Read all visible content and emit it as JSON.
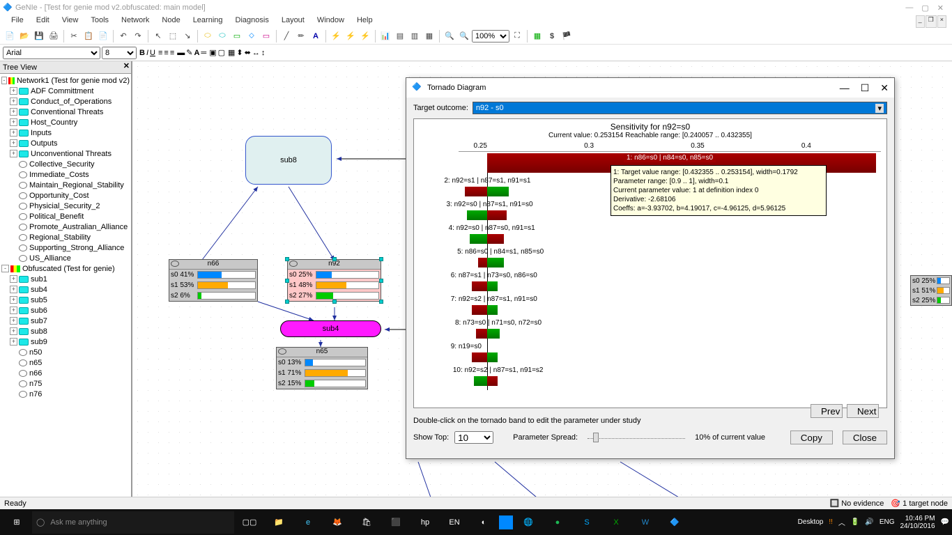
{
  "app": {
    "title": "GeNIe - [Test for genie mod v2.obfuscated: main model]"
  },
  "menu": {
    "items": [
      "File",
      "Edit",
      "View",
      "Tools",
      "Network",
      "Node",
      "Learning",
      "Diagnosis",
      "Layout",
      "Window",
      "Help"
    ]
  },
  "zoom": "100%",
  "font": {
    "name": "Arial",
    "size": "8"
  },
  "treeview": {
    "title": "Tree View",
    "root": "Network1 (Test for genie mod v2)",
    "group1": [
      "ADF Committment",
      "Conduct_of_Operations",
      "Conventional Threats",
      "Host_Country",
      "Inputs",
      "Outputs",
      "Unconventional Threats"
    ],
    "group2": [
      "Collective_Security",
      "Immediate_Costs",
      "Maintain_Regional_Stability",
      "Opportunity_Cost",
      "Physicial_Security_2",
      "Political_Benefit",
      "Promote_Australian_Alliance",
      "Regional_Stability",
      "Supporting_Strong_Alliance",
      "US_Alliance"
    ],
    "root2": "Obfuscated (Test for genie)",
    "group3": [
      "sub1",
      "sub4",
      "sub5",
      "sub6",
      "sub7",
      "sub8",
      "sub9"
    ],
    "group4": [
      "n50",
      "n65",
      "n66",
      "n75",
      "n76"
    ]
  },
  "nodes": {
    "sub8": "sub8",
    "sub4": "sub4",
    "n66": {
      "name": "n66",
      "rows": [
        {
          "l": "s0 41%",
          "w": 41,
          "c": "#08f"
        },
        {
          "l": "s1 53%",
          "w": 53,
          "c": "#fa0"
        },
        {
          "l": "s2  6%",
          "w": 6,
          "c": "#0c0"
        }
      ]
    },
    "n92": {
      "name": "n92",
      "rows": [
        {
          "l": "s0 25%",
          "w": 25,
          "c": "#08f"
        },
        {
          "l": "s1 48%",
          "w": 48,
          "c": "#fa0"
        },
        {
          "l": "s2 27%",
          "w": 27,
          "c": "#0c0"
        }
      ]
    },
    "n65": {
      "name": "n65",
      "rows": [
        {
          "l": "s0 13%",
          "w": 13,
          "c": "#08f"
        },
        {
          "l": "s1 71%",
          "w": 71,
          "c": "#fa0"
        },
        {
          "l": "s2 15%",
          "w": 15,
          "c": "#0c0"
        }
      ]
    },
    "partial": {
      "rows": [
        {
          "l": "s0 25%",
          "w": 25,
          "c": "#08f"
        },
        {
          "l": "s1 51%",
          "w": 51,
          "c": "#fa0"
        },
        {
          "l": "s2 25%",
          "w": 25,
          "c": "#0c0"
        }
      ]
    }
  },
  "dialog": {
    "title": "Tornado Diagram",
    "target_label": "Target outcome:",
    "target_value": "n92 - s0",
    "hint": "Double-click on the tornado band to edit the parameter under study",
    "show_top_label": "Show Top:",
    "show_top_value": "10",
    "spread_label": "Parameter Spread:",
    "spread_value": "10% of current value",
    "prev": "Prev",
    "next": "Next",
    "copy": "Copy",
    "close": "Close"
  },
  "chart_data": {
    "type": "bar",
    "title": "Sensitivity for n92=s0",
    "subtitle": "Current value: 0.253154  Reachable range: [0.240057 .. 0.432355]",
    "xticks": [
      0.25,
      0.3,
      0.35,
      0.4
    ],
    "xmin": 0.24,
    "xmax": 0.435,
    "current": 0.253154,
    "rows": [
      {
        "i": 1,
        "label": "1: n86=s0 | n84=s0, n85=s0",
        "lo": 0.253,
        "hi": 0.432,
        "lcol": "red",
        "rcol": "red",
        "full": true
      },
      {
        "i": 2,
        "label": "2: n92=s1 | n87=s1, n91=s1",
        "lo": 0.243,
        "hi": 0.263,
        "lcol": "red",
        "rcol": "grn"
      },
      {
        "i": 3,
        "label": "3: n92=s0 | n87=s1, n91=s0",
        "lo": 0.244,
        "hi": 0.262,
        "lcol": "grn",
        "rcol": "red"
      },
      {
        "i": 4,
        "label": "4: n92=s0 | n87=s0, n91=s1",
        "lo": 0.245,
        "hi": 0.261,
        "lcol": "grn",
        "rcol": "red"
      },
      {
        "i": 5,
        "label": "5: n86=s0 | n84=s1, n85=s0",
        "lo": 0.249,
        "hi": 0.261,
        "lcol": "red",
        "rcol": "grn"
      },
      {
        "i": 6,
        "label": "6: n87=s1 | n73=s0, n86=s0",
        "lo": 0.246,
        "hi": 0.258,
        "lcol": "red",
        "rcol": "grn"
      },
      {
        "i": 7,
        "label": "7: n92=s2 | n87=s1, n91=s0",
        "lo": 0.246,
        "hi": 0.258,
        "lcol": "red",
        "rcol": "grn"
      },
      {
        "i": 8,
        "label": "8: n73=s0 | n71=s0, n72=s0",
        "lo": 0.248,
        "hi": 0.259,
        "lcol": "red",
        "rcol": "grn"
      },
      {
        "i": 9,
        "label": "9: n19=s0",
        "lo": 0.246,
        "hi": 0.258,
        "lcol": "red",
        "rcol": "grn"
      },
      {
        "i": 10,
        "label": "10: n92=s2 | n87=s1, n91=s2",
        "lo": 0.247,
        "hi": 0.258,
        "lcol": "grn",
        "rcol": "red"
      }
    ]
  },
  "tooltip": {
    "l1": "1: Target value range: [0.432355 .. 0.253154], width=0.1792",
    "l2": "Parameter range: [0.9 .. 1], width=0.1",
    "l3": "Current parameter value: 1 at definition index 0",
    "l4": "Derivative: -2.68106",
    "l5": "Coeffs: a=-3.93702, b=4.19017, c=-4.96125, d=5.96125"
  },
  "status": {
    "ready": "Ready",
    "evidence": "No evidence",
    "targets": "1 target node"
  },
  "taskbar": {
    "cortana": "Ask me anything",
    "desktop": "Desktop",
    "lang": "ENG",
    "time": "10:46 PM",
    "date": "24/10/2016"
  }
}
